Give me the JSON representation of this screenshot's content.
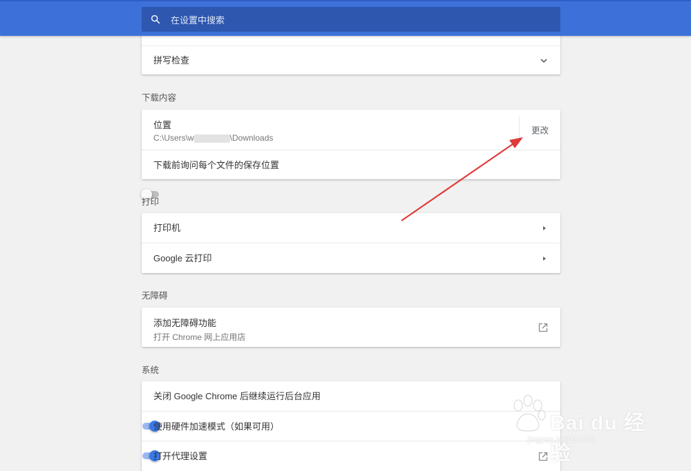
{
  "search": {
    "placeholder": "在设置中搜索"
  },
  "spellcheck": {
    "label": "拼写检查"
  },
  "downloads": {
    "section_title": "下载内容",
    "location_label": "位置",
    "path_prefix": "C:\\Users\\w",
    "path_suffix": "\\Downloads",
    "change_label": "更改",
    "ask_label": "下载前询问每个文件的保存位置",
    "ask_enabled": false
  },
  "print": {
    "section_title": "打印",
    "printers_label": "打印机",
    "cloud_print_label": "Google 云打印"
  },
  "accessibility": {
    "section_title": "无障碍",
    "add_label": "添加无障碍功能",
    "add_sub": "打开 Chrome 网上应用店"
  },
  "system": {
    "section_title": "系统",
    "background_label": "关闭 Google Chrome 后继续运行后台应用",
    "background_enabled": true,
    "hw_accel_label": "使用硬件加速模式（如果可用）",
    "hw_accel_enabled": true,
    "proxy_label": "打开代理设置"
  },
  "watermark": {
    "brand": "Bai du 经验",
    "url": "jingyan.baidu.com"
  },
  "colors": {
    "accent": "#3d71d9",
    "toggle_on": "#3b78e7",
    "arrow": "#e03a3a"
  }
}
